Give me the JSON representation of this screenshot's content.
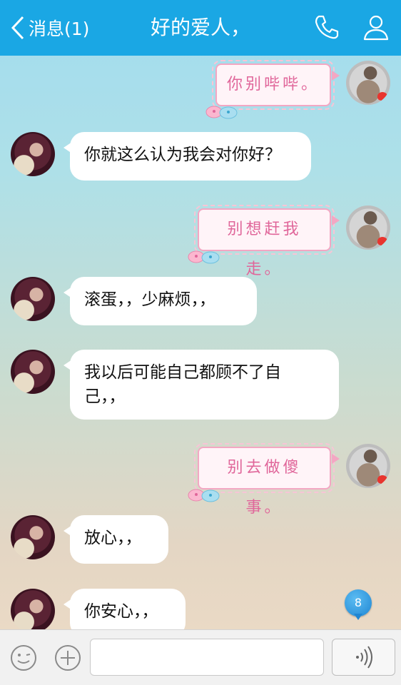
{
  "header": {
    "back_label": "消息(1)",
    "title": "好的爱人，"
  },
  "messages": [
    {
      "sender": "me",
      "text": "你别哔哔。"
    },
    {
      "sender": "her",
      "text": "你就这么认为我会对你好？"
    },
    {
      "sender": "me",
      "text": "别想赶我走。"
    },
    {
      "sender": "her",
      "text": "滚蛋，，少麻烦，，"
    },
    {
      "sender": "her",
      "text": "我以后可能自己都顾不了自己，，"
    },
    {
      "sender": "me",
      "text": "别去做傻事。"
    },
    {
      "sender": "her",
      "text": "放心，，"
    },
    {
      "sender": "her",
      "text": "你安心，，"
    }
  ],
  "unread_badge": "8",
  "input": {
    "value": ""
  },
  "colors": {
    "header": "#1aa7e4",
    "pink_text": "#e0669a",
    "badge": "#1f86d3"
  },
  "icons": [
    "chevron-left-icon",
    "phone-icon",
    "contact-icon",
    "emoji-icon",
    "plus-icon",
    "voice-icon"
  ]
}
